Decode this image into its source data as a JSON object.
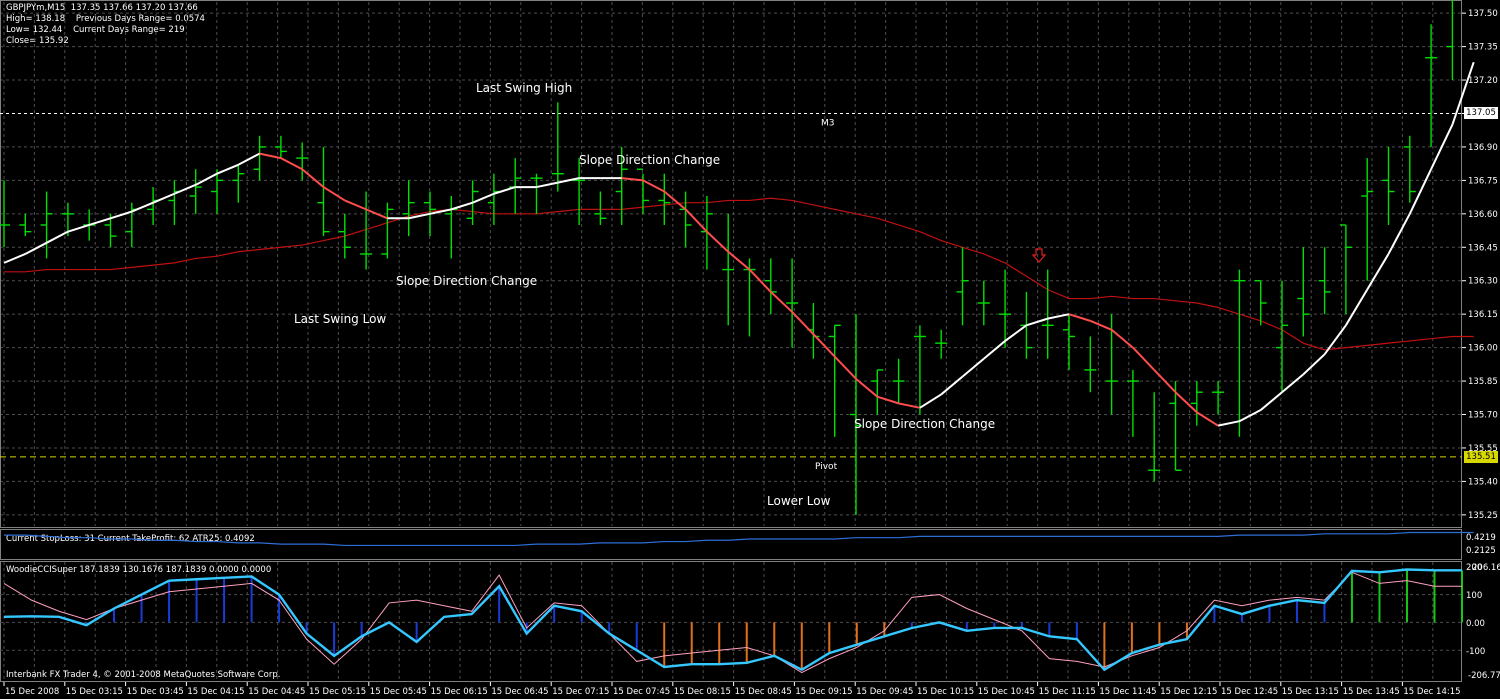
{
  "header": {
    "symbol_line": "GBPJPYm,M15  137.35 137.66 137.20 137.66",
    "high_line": "High= 138.18    Previous Days Range= 0.0574",
    "low_line": "Low= 132.44    Current Days Range= 219",
    "close_line": "Close= 135.92"
  },
  "price_axis": {
    "ticks": [
      "137.50",
      "137.35",
      "137.20",
      "137.05",
      "136.90",
      "136.75",
      "136.60",
      "136.45",
      "136.30",
      "136.15",
      "136.00",
      "135.85",
      "135.70",
      "135.55",
      "135.40",
      "135.25"
    ],
    "tick_values": [
      137.5,
      137.35,
      137.2,
      137.05,
      136.9,
      136.75,
      136.6,
      136.45,
      136.3,
      136.15,
      136.0,
      135.85,
      135.7,
      135.55,
      135.4,
      135.25
    ],
    "m3_box": "137.05",
    "pivot_box": "135.51"
  },
  "levels": {
    "m3": 137.05,
    "pivot": 135.51,
    "m3_label": "M3",
    "pivot_label": "Pivot"
  },
  "annotations": {
    "last_swing_high": "Last Swing High",
    "slope_change_1": "Slope Direction Change",
    "slope_change_2": "Slope Direction Change",
    "last_swing_low": "Last Swing Low",
    "slope_change_3": "Slope Direction Change",
    "lower_low": "Lower Low"
  },
  "atr_panel": {
    "label": "Current StopLoss: 31  Current TakeProfit: 62  ATR25:  0.4092",
    "ticks": [
      "0.4219",
      "0.2125"
    ]
  },
  "cci_panel": {
    "label": "WoodieCCISuper 187.1839 130.1676 187.1839 0.0000 0.0000",
    "ticks": [
      "200",
      "206.163",
      "100",
      "0.00",
      "-100",
      "-206.777"
    ]
  },
  "footer": {
    "copyright": "Interbank FX Trader 4, © 2001-2008 MetaQuotes Software Corp."
  },
  "time_axis": [
    "15 Dec 2008",
    "15 Dec 03:15",
    "15 Dec 03:45",
    "15 Dec 04:15",
    "15 Dec 04:45",
    "15 Dec 05:15",
    "15 Dec 05:45",
    "15 Dec 06:15",
    "15 Dec 06:45",
    "15 Dec 07:15",
    "15 Dec 07:45",
    "15 Dec 08:15",
    "15 Dec 08:45",
    "15 Dec 09:15",
    "15 Dec 09:45",
    "15 Dec 10:15",
    "15 Dec 10:45",
    "15 Dec 11:15",
    "15 Dec 11:45",
    "15 Dec 12:15",
    "15 Dec 12:45",
    "15 Dec 13:15",
    "15 Dec 13:45",
    "15 Dec 14:15"
  ],
  "colors": {
    "bar": "#00e000",
    "grid": "#4d4d4d",
    "slow_ma": "#c01010",
    "fast_up": "#ffffff",
    "fast_down": "#ff4d4d",
    "atr": "#2e6fd6",
    "cci_main": "#35c7ff",
    "cci_thin": "#ff9fbf",
    "hist_blue": "#1a3bd6",
    "hist_green": "#19c419",
    "hist_orange": "#e0701a",
    "pivot_box": "#d8d800",
    "m3_box": "#ffffff"
  },
  "chart_data": {
    "type": "ohlc",
    "timeframe": "M15",
    "bars_ohlc": [
      [
        136.55,
        136.75,
        136.45,
        136.55
      ],
      [
        136.55,
        136.6,
        136.5,
        136.52
      ],
      [
        136.55,
        136.7,
        136.4,
        136.6
      ],
      [
        136.6,
        136.65,
        136.5,
        136.6
      ],
      [
        136.55,
        136.62,
        136.48,
        136.55
      ],
      [
        136.55,
        136.6,
        136.45,
        136.5
      ],
      [
        136.52,
        136.65,
        136.45,
        136.62
      ],
      [
        136.62,
        136.72,
        136.55,
        136.66
      ],
      [
        136.66,
        136.75,
        136.55,
        136.7
      ],
      [
        136.68,
        136.8,
        136.6,
        136.72
      ],
      [
        136.7,
        136.8,
        136.6,
        136.75
      ],
      [
        136.75,
        136.82,
        136.65,
        136.78
      ],
      [
        136.8,
        136.95,
        136.75,
        136.9
      ],
      [
        136.9,
        136.95,
        136.85,
        136.88
      ],
      [
        136.85,
        136.92,
        136.75,
        136.85
      ],
      [
        136.65,
        136.9,
        136.5,
        136.52
      ],
      [
        136.52,
        136.6,
        136.4,
        136.45
      ],
      [
        136.42,
        136.7,
        136.35,
        136.42
      ],
      [
        136.42,
        136.65,
        136.4,
        136.62
      ],
      [
        136.6,
        136.75,
        136.5,
        136.65
      ],
      [
        136.65,
        136.7,
        136.5,
        136.62
      ],
      [
        136.6,
        136.68,
        136.4,
        136.62
      ],
      [
        136.58,
        136.75,
        136.55,
        136.7
      ],
      [
        136.65,
        136.78,
        136.55,
        136.7
      ],
      [
        136.72,
        136.85,
        136.6,
        136.76
      ],
      [
        136.76,
        136.78,
        136.6,
        136.76
      ],
      [
        136.78,
        137.1,
        136.7,
        136.78
      ],
      [
        136.75,
        136.85,
        136.55,
        136.75
      ],
      [
        136.6,
        136.7,
        136.55,
        136.58
      ],
      [
        136.7,
        136.9,
        136.55,
        136.8
      ],
      [
        136.8,
        136.78,
        136.6,
        136.66
      ],
      [
        136.66,
        136.78,
        136.55,
        136.65
      ],
      [
        136.62,
        136.7,
        136.45,
        136.55
      ],
      [
        136.52,
        136.68,
        136.35,
        136.6
      ],
      [
        136.35,
        136.6,
        136.1,
        136.35
      ],
      [
        136.35,
        136.4,
        136.05,
        136.35
      ],
      [
        136.3,
        136.4,
        136.15,
        136.25
      ],
      [
        136.2,
        136.4,
        136.0,
        136.2
      ],
      [
        136.08,
        136.2,
        135.95,
        136.05
      ],
      [
        136.05,
        136.1,
        135.6,
        136.1
      ],
      [
        135.7,
        136.15,
        135.25,
        135.65
      ],
      [
        135.85,
        135.9,
        135.7,
        135.9
      ],
      [
        135.85,
        135.95,
        135.75,
        135.85
      ],
      [
        136.05,
        136.1,
        135.7,
        136.05
      ],
      [
        136.02,
        136.08,
        135.95,
        136.02
      ],
      [
        136.25,
        136.45,
        136.1,
        136.3
      ],
      [
        136.2,
        136.3,
        136.1,
        136.2
      ],
      [
        136.15,
        136.35,
        136.0,
        136.15
      ],
      [
        136.1,
        136.25,
        135.95,
        136.0
      ],
      [
        136.1,
        136.35,
        135.95,
        136.1
      ],
      [
        136.08,
        136.15,
        135.9,
        136.05
      ],
      [
        135.9,
        136.05,
        135.8,
        135.9
      ],
      [
        135.85,
        136.15,
        135.7,
        135.85
      ],
      [
        135.85,
        135.9,
        135.6,
        135.85
      ],
      [
        135.45,
        135.8,
        135.4,
        135.45
      ],
      [
        135.75,
        135.85,
        135.45,
        135.45
      ],
      [
        135.75,
        135.85,
        135.65,
        135.8
      ],
      [
        135.8,
        135.85,
        135.7,
        135.8
      ],
      [
        136.3,
        136.35,
        135.6,
        136.3
      ],
      [
        136.3,
        136.3,
        136.1,
        136.2
      ],
      [
        136.0,
        136.3,
        135.8,
        136.1
      ],
      [
        136.22,
        136.45,
        136.05,
        136.15
      ],
      [
        136.3,
        136.45,
        136.15,
        136.25
      ],
      [
        136.55,
        136.55,
        136.15,
        136.45
      ],
      [
        136.68,
        136.85,
        136.3,
        136.7
      ],
      [
        136.75,
        136.9,
        136.55,
        136.7
      ],
      [
        136.9,
        136.95,
        136.65,
        136.7
      ],
      [
        137.3,
        137.45,
        136.9,
        137.3
      ],
      [
        137.35,
        137.66,
        137.2,
        137.66
      ]
    ],
    "fast_ma": [
      136.38,
      136.42,
      136.47,
      136.52,
      136.55,
      136.58,
      136.61,
      136.65,
      136.69,
      136.73,
      136.78,
      136.82,
      136.87,
      136.85,
      136.8,
      136.72,
      136.66,
      136.62,
      136.58,
      136.58,
      136.6,
      136.62,
      136.65,
      136.69,
      136.72,
      136.72,
      136.74,
      136.76,
      136.76,
      136.76,
      136.75,
      136.7,
      136.62,
      136.52,
      136.43,
      136.35,
      136.25,
      136.16,
      136.06,
      135.96,
      135.86,
      135.78,
      135.75,
      135.73,
      135.79,
      135.87,
      135.95,
      136.03,
      136.1,
      136.13,
      136.15,
      136.12,
      136.08,
      136.0,
      135.9,
      135.8,
      135.71,
      135.65,
      135.67,
      135.72,
      135.8,
      135.88,
      135.97,
      136.1,
      136.26,
      136.42,
      136.6,
      136.8,
      137.0,
      137.28
    ],
    "slow_ma": [
      136.34,
      136.34,
      136.35,
      136.35,
      136.35,
      136.35,
      136.36,
      136.37,
      136.38,
      136.4,
      136.41,
      136.43,
      136.44,
      136.45,
      136.46,
      136.48,
      136.5,
      136.53,
      136.56,
      136.59,
      136.61,
      136.62,
      136.61,
      136.6,
      136.6,
      136.6,
      136.61,
      136.62,
      136.62,
      136.62,
      136.63,
      136.64,
      136.65,
      136.65,
      136.66,
      136.66,
      136.67,
      136.66,
      136.64,
      136.62,
      136.6,
      136.58,
      136.55,
      136.52,
      136.48,
      136.45,
      136.42,
      136.38,
      136.32,
      136.26,
      136.22,
      136.22,
      136.23,
      136.22,
      136.22,
      136.21,
      136.2,
      136.18,
      136.15,
      136.12,
      136.08,
      136.02,
      135.99,
      136.0,
      136.01,
      136.02,
      136.03,
      136.04,
      136.05,
      136.05
    ],
    "atr": [
      0.39,
      0.39,
      0.38,
      0.37,
      0.37,
      0.36,
      0.36,
      0.35,
      0.35,
      0.34,
      0.34,
      0.33,
      0.33,
      0.32,
      0.32,
      0.32,
      0.31,
      0.31,
      0.31,
      0.31,
      0.31,
      0.31,
      0.31,
      0.31,
      0.31,
      0.32,
      0.32,
      0.32,
      0.33,
      0.33,
      0.33,
      0.34,
      0.34,
      0.35,
      0.35,
      0.36,
      0.36,
      0.36,
      0.36,
      0.36,
      0.37,
      0.37,
      0.37,
      0.38,
      0.38,
      0.38,
      0.38,
      0.38,
      0.38,
      0.38,
      0.38,
      0.38,
      0.38,
      0.38,
      0.38,
      0.38,
      0.38,
      0.38,
      0.39,
      0.39,
      0.39,
      0.39,
      0.4,
      0.4,
      0.4,
      0.4,
      0.41,
      0.41,
      0.41,
      0.41
    ],
    "cci_main": [
      20,
      22,
      20,
      -10,
      50,
      100,
      150,
      155,
      160,
      165,
      100,
      -40,
      -120,
      -50,
      0,
      -70,
      20,
      30,
      130,
      -40,
      60,
      40,
      -40,
      -100,
      -160,
      -150,
      -150,
      -145,
      -120,
      -170,
      -110,
      -80,
      -50,
      -20,
      0,
      -30,
      -20,
      -20,
      -50,
      -60,
      -170,
      -110,
      -80,
      -60,
      60,
      30,
      60,
      80,
      70,
      185,
      180,
      190,
      187,
      187
    ],
    "cci_thin": [
      140,
      80,
      40,
      10,
      50,
      80,
      110,
      120,
      130,
      140,
      80,
      -60,
      -150,
      -60,
      70,
      80,
      60,
      40,
      170,
      -20,
      70,
      60,
      -40,
      -140,
      -120,
      -110,
      -100,
      -90,
      -120,
      -180,
      -130,
      -90,
      -30,
      90,
      100,
      50,
      10,
      -30,
      -130,
      -140,
      -160,
      -120,
      -90,
      -30,
      80,
      60,
      80,
      90,
      80,
      180,
      140,
      150,
      130,
      130
    ],
    "cci_hist": [
      0,
      0,
      0,
      -1,
      1,
      1,
      1,
      1,
      1,
      1,
      1,
      -1,
      -1,
      -1,
      0,
      -1,
      0,
      0,
      1,
      -1,
      1,
      1,
      -1,
      -1,
      -2,
      -2,
      -2,
      -2,
      -2,
      -2,
      -2,
      -2,
      -2,
      -1,
      0,
      -1,
      -1,
      -1,
      -1,
      -1,
      -2,
      -2,
      -2,
      -2,
      1,
      1,
      1,
      1,
      1,
      3,
      3,
      3,
      3,
      3
    ]
  }
}
